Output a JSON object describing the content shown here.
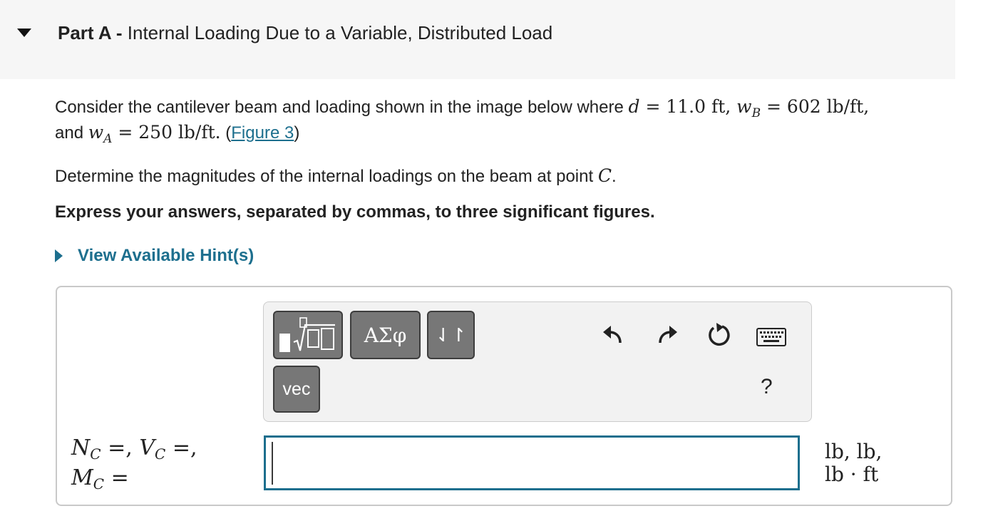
{
  "part": {
    "label": "Part A -",
    "title": "Internal Loading Due to a Variable, Distributed Load"
  },
  "problem": {
    "line1_text": "Consider the cantilever beam and loading shown in the image below where",
    "d_symbol": "d",
    "d_value": "= 11.0 ft,",
    "wB_symbol": "w",
    "wB_sub": "B",
    "wB_value": "= 602 lb/ft,",
    "and_text": "and",
    "wA_symbol": "w",
    "wA_sub": "A",
    "wA_value": "= 250 lb/ft.",
    "figure_open": "(",
    "figure_link": "Figure 3",
    "figure_close": ")",
    "determine_text": "Determine the magnitudes of the internal loadings on the beam at point",
    "point_symbol": "C",
    "period": ".",
    "instruction": "Express your answers, separated by commas, to three significant figures."
  },
  "hint": {
    "label": "View Available Hint(s)"
  },
  "toolbar": {
    "greek_label": "ΑΣφ",
    "arrows_label": "⇃↾",
    "vec_label": "vec",
    "help_label": "?",
    "icons": [
      "templates-icon",
      "undo-icon",
      "redo-icon",
      "reset-icon",
      "keyboard-icon"
    ]
  },
  "answer": {
    "lhs_line1_N": "N",
    "lhs_line1_Nsub": "C",
    "lhs_line1_mid": " =, ",
    "lhs_line1_V": "V",
    "lhs_line1_Vsub": "C",
    "lhs_line1_end": " =,",
    "lhs_line2_M": "M",
    "lhs_line2_Msub": "C",
    "lhs_line2_end": " =",
    "input_value": "",
    "units_line1": "lb, lb,",
    "units_line2": "lb · ft"
  },
  "colors": {
    "accent": "#1d6f8e",
    "header_bg": "#f6f6f6",
    "button_gray": "#777777"
  }
}
